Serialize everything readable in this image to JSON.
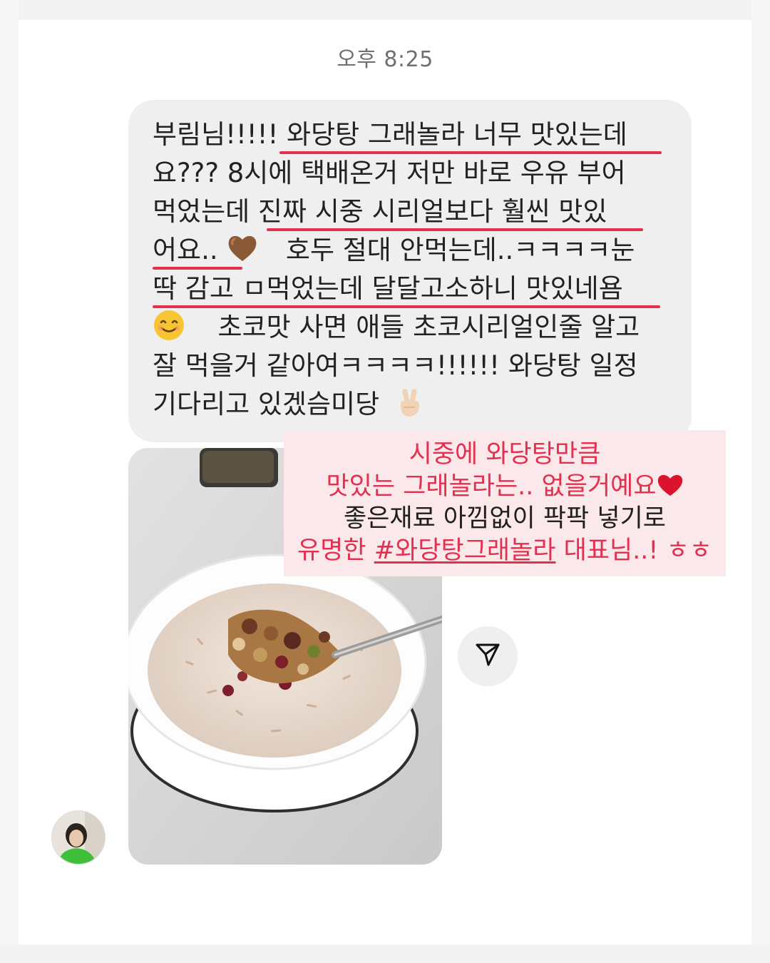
{
  "thread": {
    "timestamp": "오후 8:25"
  },
  "message": {
    "lines": [
      "부림님!!!!! 와당탕 그래놀라 너무 맛있는데",
      "요??? 8시에 택배온거 저만 바로 우유 부어",
      "먹었는데 진짜 시중 시리얼보다 훨씬 맛있",
      "어요..",
      "호두 절대 안먹는데..ㅋㅋㅋㅋ눈",
      "딱 감고 ㅁ먹었는데 달달고소하니 맛있네욤",
      "초코맛 사면 애들 초코시리얼인줄 알고",
      "잘 먹을거 같아여ㅋㅋㅋㅋ!!!!!! 와당탕 일정",
      "기다리고 있겠슴미당"
    ],
    "emojis": [
      "brown-heart",
      "smiling-face",
      "victory-hand"
    ]
  },
  "overlay": {
    "line1": "시중에 와당탕만큼",
    "line2": "맛있는 그래놀라는.. 없을거예요",
    "line3": "좋은재료 아낌없이 팍팍 넣기로",
    "line4_prefix": "유명한 ",
    "line4_hashtag": "#와당탕그래놀라",
    "line4_suffix": " 대표님..! ㅎㅎ"
  },
  "photo": {
    "description_icon": "granola-bowl-photo"
  },
  "actions": {
    "share_icon": "send-icon"
  },
  "colors": {
    "underline": "#e42f51",
    "overlay_bg": "#fbe8ea",
    "overlay_pink": "#e42f4f",
    "bubble_bg": "#efefef"
  }
}
